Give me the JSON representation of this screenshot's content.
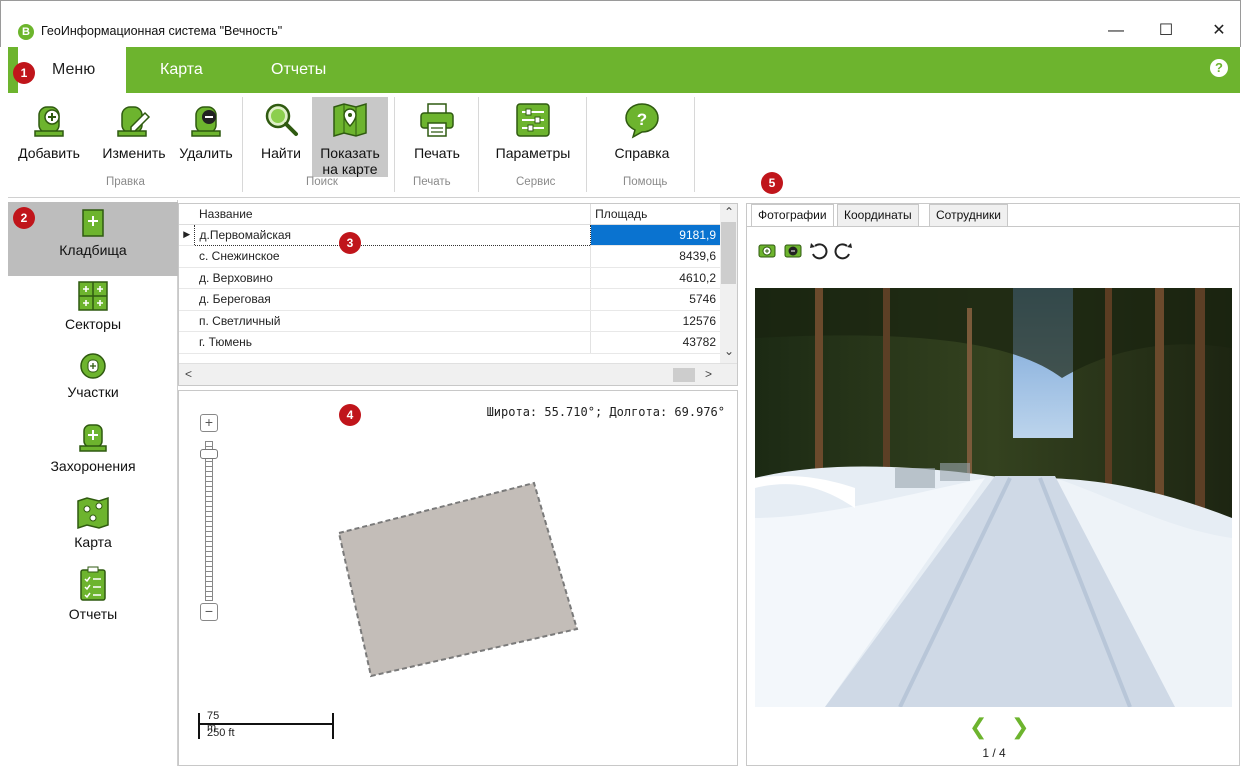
{
  "window": {
    "title": "ГеоИнформационная система \"Вечность\"",
    "logo_letter": "В",
    "minimize": "—",
    "maximize": "☐",
    "close": "✕"
  },
  "tabs": [
    {
      "label": "Меню",
      "active": true
    },
    {
      "label": "Карта",
      "active": false
    },
    {
      "label": "Отчеты",
      "active": false
    }
  ],
  "help_icon": "?",
  "badges": [
    "1",
    "2",
    "3",
    "4",
    "5"
  ],
  "toolbar": {
    "add": "Добавить",
    "edit": "Изменить",
    "delete": "Удалить",
    "find": "Найти",
    "show_on_map_line1": "Показать",
    "show_on_map_line2": "на карте",
    "print": "Печать",
    "params": "Параметры",
    "help": "Справка",
    "groups": {
      "edit": "Правка",
      "search": "Поиск",
      "print": "Печать",
      "service": "Сервис",
      "help": "Помощь"
    }
  },
  "nav": [
    {
      "label": "Кладбища",
      "icon": "cemetery-icon",
      "active": true
    },
    {
      "label": "Секторы",
      "icon": "sectors-icon",
      "active": false
    },
    {
      "label": "Участки",
      "icon": "plots-icon",
      "active": false
    },
    {
      "label": "Захоронения",
      "icon": "burials-icon",
      "active": false
    },
    {
      "label": "Карта",
      "icon": "map-icon",
      "active": false
    },
    {
      "label": "Отчеты",
      "icon": "reports-icon",
      "active": false
    }
  ],
  "grid": {
    "columns": [
      "Название",
      "Площадь"
    ],
    "rows": [
      {
        "name": "д.Первомайская",
        "area": "9181,9",
        "selected": true
      },
      {
        "name": "с. Снежинское",
        "area": "8439,6",
        "selected": false
      },
      {
        "name": "д. Верховино",
        "area": "4610,2",
        "selected": false
      },
      {
        "name": "д. Береговая",
        "area": "5746",
        "selected": false
      },
      {
        "name": "п. Светличный",
        "area": "12576",
        "selected": false
      },
      {
        "name": "г. Тюмень",
        "area": "43782",
        "selected": false
      }
    ]
  },
  "map": {
    "coords": "Широта: 55.710°; Долгота: 69.976°",
    "zoom_in": "+",
    "zoom_out": "−",
    "scale_m": "75 m",
    "scale_ft": "250 ft"
  },
  "panel": {
    "tabs": [
      {
        "label": "Фотографии",
        "active": true
      },
      {
        "label": "Координаты",
        "active": false
      },
      {
        "label": "Сотрудники",
        "active": false
      }
    ],
    "pager": "1 / 4",
    "prev": "❮",
    "next": "❯"
  },
  "colors": {
    "accent_green": "#6db42e",
    "selection_blue": "#0a73d0",
    "badge_red": "#c0151b"
  }
}
